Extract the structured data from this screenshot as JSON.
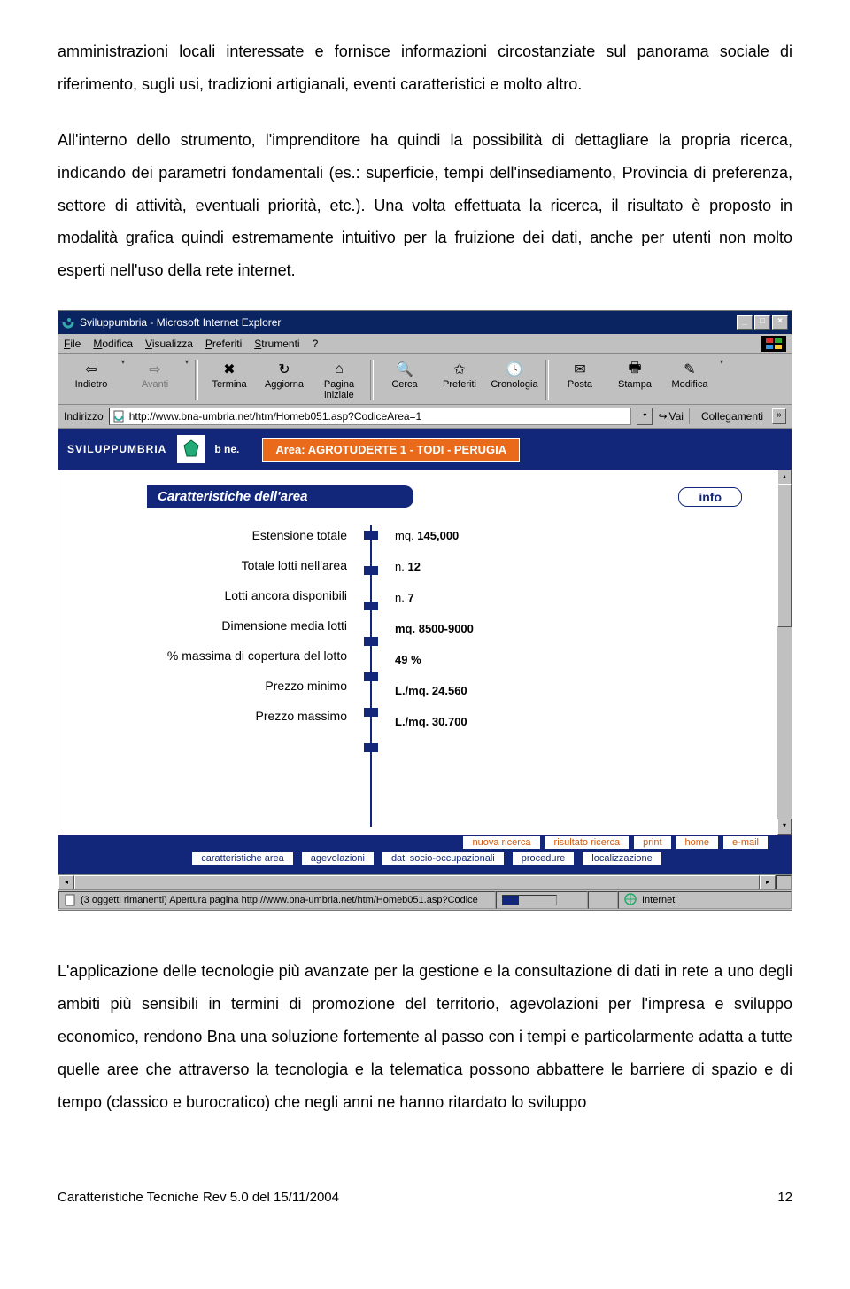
{
  "body_top": "amministrazioni locali interessate e fornisce informazioni circostanziate sul panorama sociale di riferimento, sugli usi, tradizioni artigianali, eventi caratteristici e molto altro.",
  "body_mid": "All'interno dello strumento, l'imprenditore ha quindi la possibilità di dettagliare la propria ricerca, indicando dei parametri fondamentali (es.: superficie, tempi dell'insediamento, Provincia di preferenza, settore di attività, eventuali priorità, etc.). Una volta effettuata la ricerca, il risultato è proposto in modalità grafica quindi estremamente intuitivo per la fruizione dei dati, anche per utenti non molto esperti nell'uso della rete internet.",
  "body_bottom": "L'applicazione delle tecnologie più avanzate per la gestione e la consultazione di dati in rete a uno degli ambiti più sensibili in termini di promozione del territorio, agevolazioni per l'impresa e sviluppo economico, rendono Bna una soluzione fortemente al passo con i tempi e particolarmente adatta a tutte quelle aree che attraverso la tecnologia e la telematica possono abbattere le barriere di spazio e di tempo (classico e burocratico) che negli anni ne hanno ritardato lo sviluppo",
  "footer_left": "Caratteristiche Tecniche Rev 5.0 del 15/11/2004",
  "footer_right": "12",
  "browser": {
    "title": "Sviluppumbria - Microsoft Internet Explorer",
    "menu": {
      "file": "File",
      "modifica": "Modifica",
      "visualizza": "Visualizza",
      "preferiti": "Preferiti",
      "strumenti": "Strumenti",
      "help": "?"
    },
    "toolbar": {
      "indietro": "Indietro",
      "avanti": "Avanti",
      "termina": "Termina",
      "aggiorna": "Aggiorna",
      "pagina_iniziale": "Pagina iniziale",
      "cerca": "Cerca",
      "preferiti": "Preferiti",
      "cronologia": "Cronologia",
      "posta": "Posta",
      "stampa": "Stampa",
      "modifica": "Modifica"
    },
    "address": {
      "label": "Indirizzo",
      "url": "http://www.bna-umbria.net/htm/Homeb051.asp?CodiceArea=1",
      "go": "Vai",
      "links": "Collegamenti"
    },
    "status": {
      "text": "(3 oggetti rimanenti) Apertura pagina http://www.bna-umbria.net/htm/Homeb051.asp?Codice",
      "zone": "Internet"
    }
  },
  "page": {
    "brand": "SVILUPPUMBRIA",
    "brand2": "b ne.",
    "area_label": "Area:",
    "area_value": "AGROTUDERTE 1 - TODI - PERUGIA",
    "subtitle": "Caratteristiche dell'area",
    "info": "info",
    "rows": [
      {
        "label": "Estensione totale",
        "prefix": "mq.",
        "value": "145,000"
      },
      {
        "label": "Totale lotti nell'area",
        "prefix": "n.",
        "value": "12"
      },
      {
        "label": "Lotti ancora disponibili",
        "prefix": "n.",
        "value": "7"
      },
      {
        "label": "Dimensione media lotti",
        "prefix": "",
        "value": "mq. 8500-9000"
      },
      {
        "label": "% massima di copertura del lotto",
        "prefix": "",
        "value": "49 %"
      },
      {
        "label": "Prezzo minimo",
        "prefix": "",
        "value": "L./mq. 24.560"
      },
      {
        "label": "Prezzo massimo",
        "prefix": "",
        "value": "L./mq. 30.700"
      }
    ],
    "nav1": {
      "nuova": "nuova ricerca",
      "risultato": "risultato ricerca",
      "print": "print",
      "home": "home",
      "email": "e-mail"
    },
    "nav2": {
      "carat": "caratteristiche area",
      "agev": "agevolazioni",
      "dati": "dati socio-occupazionali",
      "proc": "procedure",
      "local": "localizzazione"
    }
  }
}
